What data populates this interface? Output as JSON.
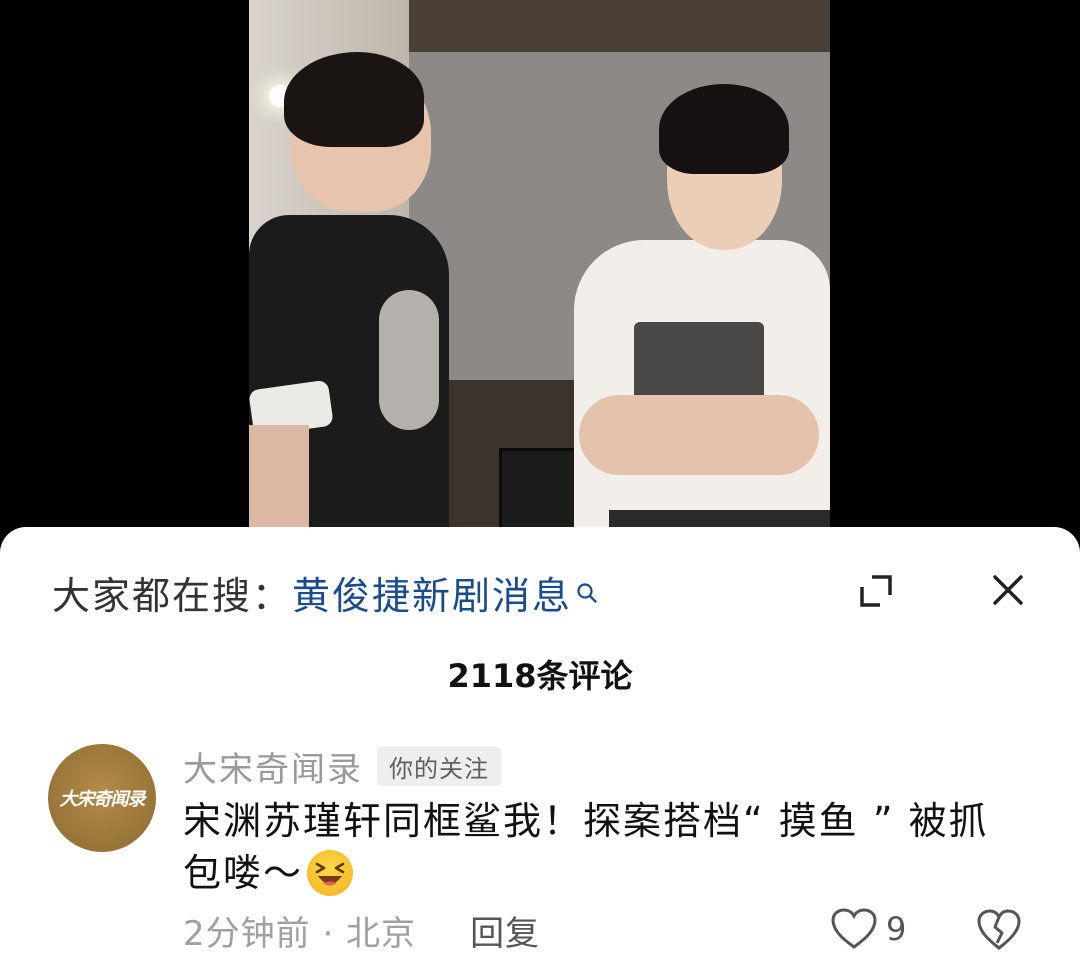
{
  "search": {
    "prefix": "大家都在搜：",
    "term": "黄俊捷新剧消息"
  },
  "comments_header": {
    "count_label": "2118条评论"
  },
  "comment": {
    "avatar_text": "大宋奇闻录",
    "author": "大宋奇闻录",
    "follow_badge": "你的关注",
    "text": "宋渊苏瑾轩同框鲨我！探案搭档“ 摸鱼 ” 被抓包喽～",
    "emoji": "laughing-squint-emoji",
    "time_location": "2分钟前 · 北京",
    "reply_label": "回复",
    "like_count": "9"
  },
  "icons": {
    "expand": "expand-icon",
    "close": "close-icon",
    "like": "heart-outline-icon",
    "dislike": "broken-heart-icon"
  },
  "colors": {
    "search_term": "#1a4c8c",
    "sheet_background": "#ffffff",
    "muted_text": "#9a9a9a"
  }
}
